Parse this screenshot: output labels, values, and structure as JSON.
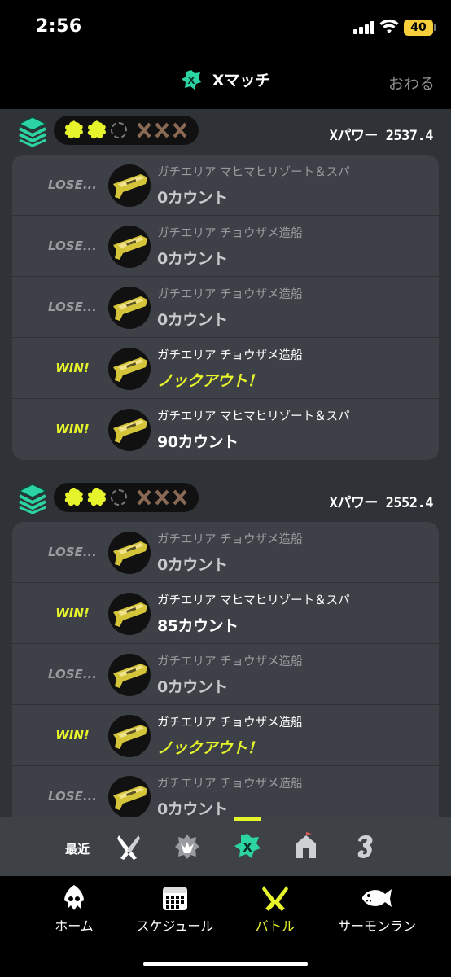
{
  "status_bar": {
    "time": "2:56",
    "battery": "40"
  },
  "header": {
    "title": "Xマッチ",
    "close_label": "おわる",
    "icon": "x-match-icon"
  },
  "colors": {
    "accent": "#e6f42b",
    "win": "#e6f42b",
    "lose": "#9a9ba0",
    "card_bg": "#3d4046",
    "page_bg": "#2f3236"
  },
  "sets": [
    {
      "rank_icon": "x-rank-icon",
      "progress": {
        "wins": 2,
        "remaining": 1,
        "losses": 3
      },
      "xpower": "Xパワー 2537.4",
      "battles": [
        {
          "result": "LOSE...",
          "outcome": "lose",
          "mode_stage": "ガチエリア マヒマヒリゾート＆スパ",
          "score": "0カウント",
          "weapon_icon": "splattershot-icon"
        },
        {
          "result": "LOSE...",
          "outcome": "lose",
          "mode_stage": "ガチエリア チョウザメ造船",
          "score": "0カウント",
          "weapon_icon": "splattershot-icon"
        },
        {
          "result": "LOSE...",
          "outcome": "lose",
          "mode_stage": "ガチエリア チョウザメ造船",
          "score": "0カウント",
          "weapon_icon": "splattershot-icon"
        },
        {
          "result": "WIN!",
          "outcome": "win",
          "mode_stage": "ガチエリア チョウザメ造船",
          "score": "ノックアウト！",
          "score_style": "yellow",
          "weapon_icon": "splattershot-icon"
        },
        {
          "result": "WIN!",
          "outcome": "win",
          "mode_stage": "ガチエリア マヒマヒリゾート＆スパ",
          "score": "90カウント",
          "score_style": "white",
          "weapon_icon": "splattershot-icon"
        }
      ]
    },
    {
      "rank_icon": "x-rank-icon",
      "progress": {
        "wins": 2,
        "remaining": 1,
        "losses": 3
      },
      "xpower": "Xパワー 2552.4",
      "battles": [
        {
          "result": "LOSE...",
          "outcome": "lose",
          "mode_stage": "ガチエリア チョウザメ造船",
          "score": "0カウント",
          "weapon_icon": "splattershot-icon"
        },
        {
          "result": "WIN!",
          "outcome": "win",
          "mode_stage": "ガチエリア マヒマヒリゾート＆スパ",
          "score": "85カウント",
          "score_style": "white",
          "weapon_icon": "splattershot-icon"
        },
        {
          "result": "LOSE...",
          "outcome": "lose",
          "mode_stage": "ガチエリア チョウザメ造船",
          "score": "0カウント",
          "weapon_icon": "splattershot-icon"
        },
        {
          "result": "WIN!",
          "outcome": "win",
          "mode_stage": "ガチエリア チョウザメ造船",
          "score": "ノックアウト！",
          "score_style": "yellow",
          "weapon_icon": "splattershot-icon"
        },
        {
          "result": "LOSE...",
          "outcome": "lose",
          "mode_stage": "ガチエリア チョウザメ造船",
          "score": "0カウント",
          "weapon_icon": "splattershot-icon"
        }
      ]
    }
  ],
  "mode_tabs": {
    "recent_label": "最近",
    "tabs": [
      {
        "icon": "regular-battle-icon",
        "active": false
      },
      {
        "icon": "anarchy-battle-icon",
        "active": false
      },
      {
        "icon": "x-battle-icon",
        "active": true
      },
      {
        "icon": "challenge-icon",
        "active": false
      },
      {
        "icon": "private-battle-icon",
        "active": false
      }
    ]
  },
  "bottom_nav": [
    {
      "label": "ホーム",
      "icon": "squid-home-icon",
      "active": false
    },
    {
      "label": "スケジュール",
      "icon": "calendar-icon",
      "active": false
    },
    {
      "label": "バトル",
      "icon": "battle-icon",
      "active": true
    },
    {
      "label": "サーモンラン",
      "icon": "salmon-icon",
      "active": false
    }
  ]
}
